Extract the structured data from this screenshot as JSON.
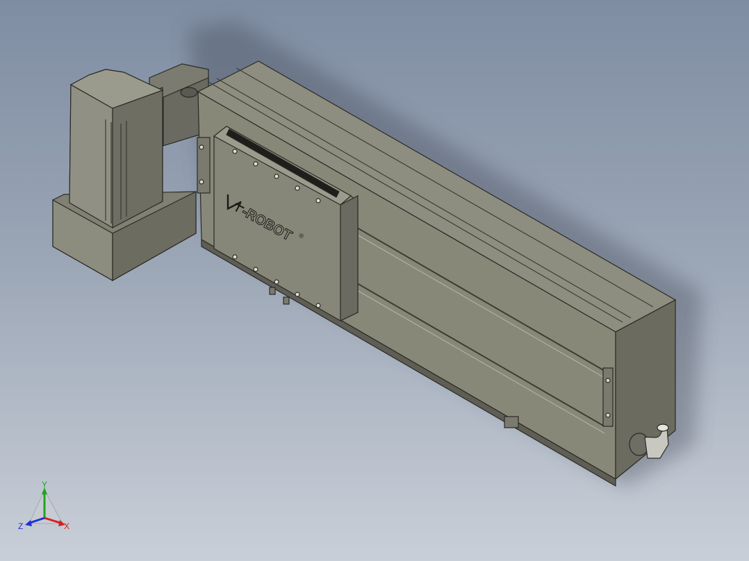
{
  "viewport": {
    "background_top": "#7f8da3",
    "background_bottom": "#c9cfd8"
  },
  "model": {
    "brand_text": "-ROBOT",
    "brand_mark": "®",
    "body_color": "#8a8a7d",
    "body_dark": "#5f5f55",
    "body_light": "#a8a89a",
    "edge_color": "#2a2a25"
  },
  "triad": {
    "x_label": "X",
    "y_label": "Y",
    "z_label": "Z",
    "x_color": "#d42020",
    "y_color": "#1fa51f",
    "z_color": "#2030d4"
  }
}
